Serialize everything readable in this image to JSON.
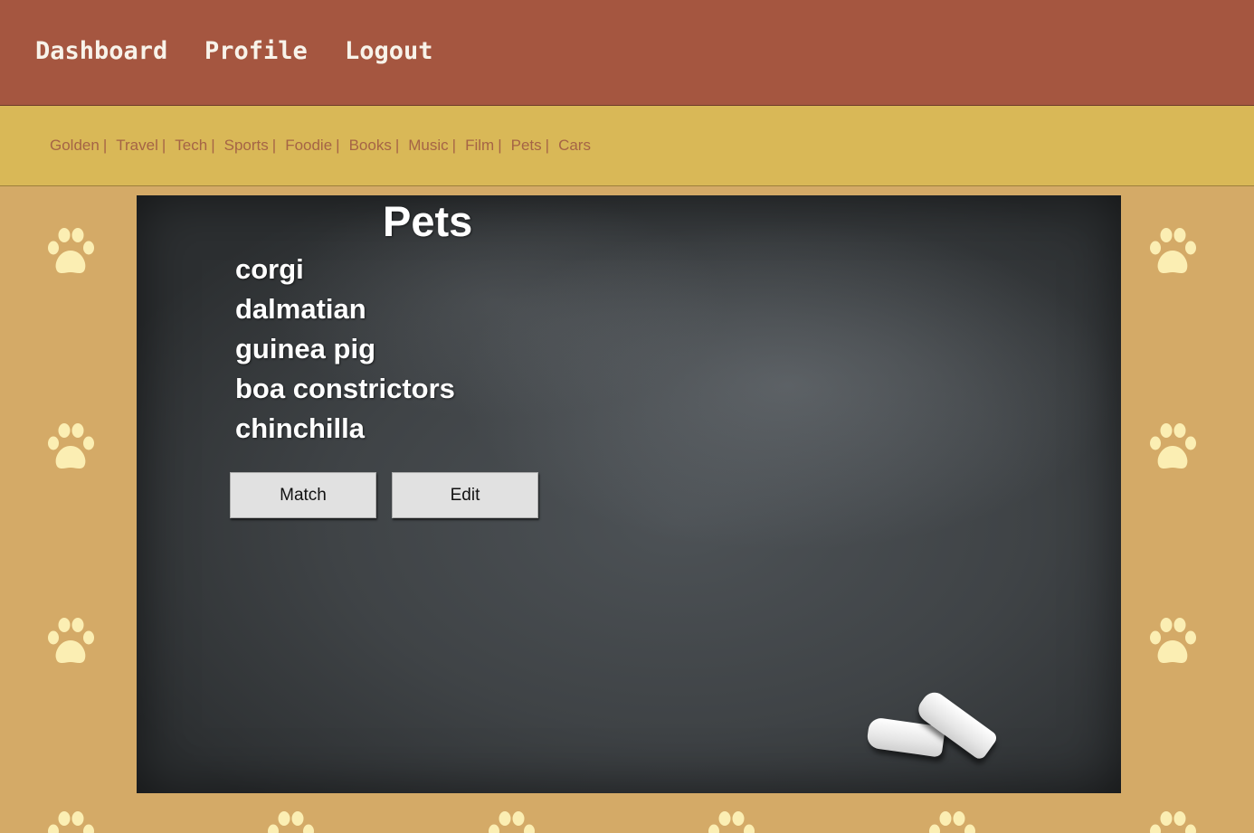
{
  "nav": {
    "dashboard": "Dashboard",
    "profile": "Profile",
    "logout": "Logout"
  },
  "categories": [
    "Golden",
    "Travel",
    "Tech",
    "Sports",
    "Foodie",
    "Books",
    "Music",
    "Film",
    "Pets",
    "Cars"
  ],
  "category_separator": "|",
  "board": {
    "title": "Pets",
    "items": [
      "corgi",
      "dalmatian",
      "guinea pig",
      "boa constrictors",
      "chinchilla"
    ],
    "match_label": "Match",
    "edit_label": "Edit"
  },
  "colors": {
    "topnav_bg": "#a55640",
    "catbar_bg": "#d9b857",
    "page_bg": "#d4aa67",
    "paw": "#fbeeb3",
    "link": "#a56446"
  },
  "icons": {
    "paw": "paw-print-icon",
    "chalk": "chalk-pieces"
  }
}
